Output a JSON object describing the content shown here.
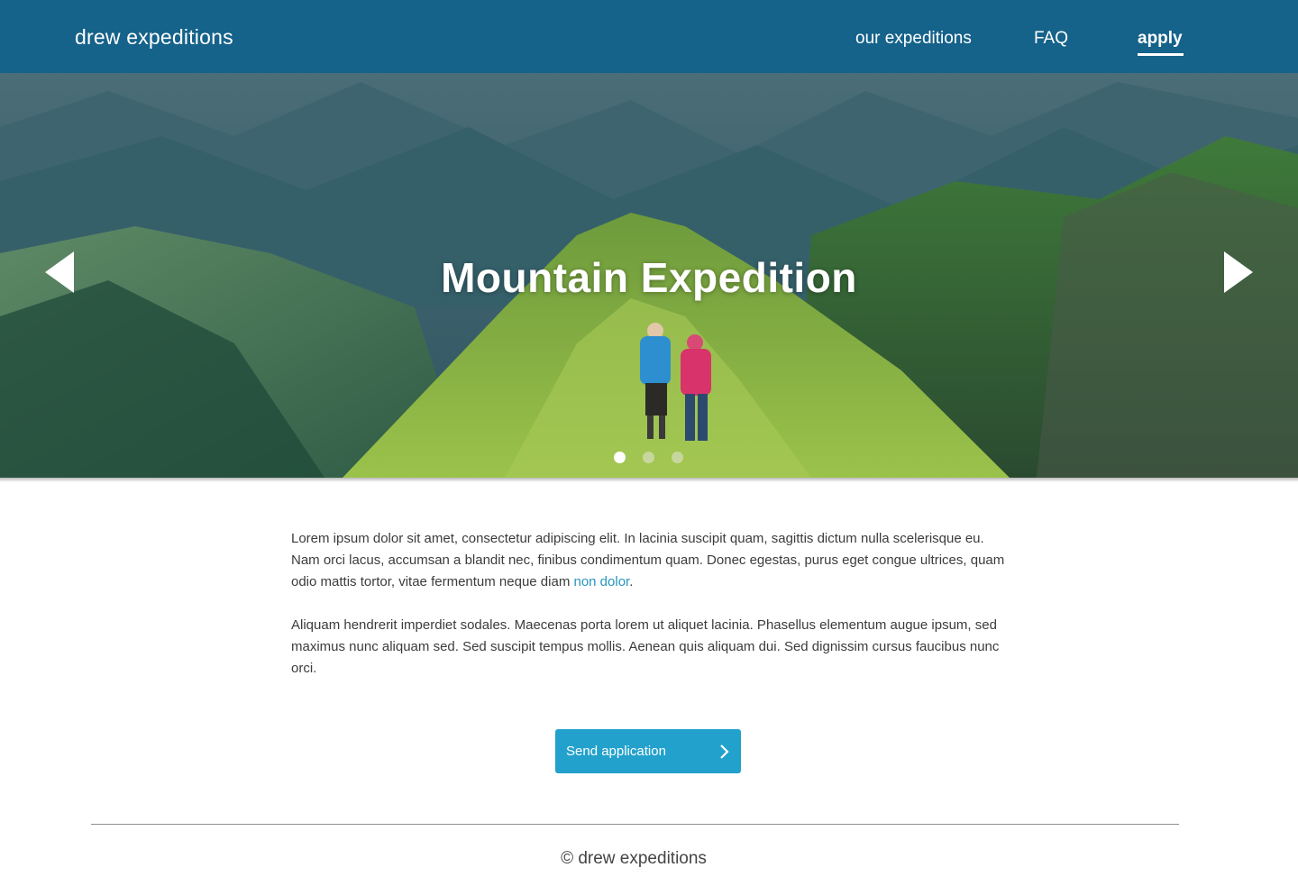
{
  "header": {
    "brand": "drew expeditions",
    "nav": [
      {
        "label": "our expeditions",
        "active": false
      },
      {
        "label": "FAQ",
        "active": false
      },
      {
        "label": "apply",
        "active": true
      }
    ]
  },
  "hero": {
    "title": "Mountain Expedition",
    "slides_total": 3,
    "active_slide": 1
  },
  "content": {
    "p1_text": "Lorem ipsum dolor sit amet, consectetur adipiscing elit. In lacinia suscipit quam, sagittis dictum nulla scelerisque eu. Nam orci lacus, accumsan a blandit nec, finibus condimentum quam. Donec egestas, purus eget congue ultrices, quam odio mattis tortor, vitae fermentum neque diam ",
    "p1_link": "non dolor",
    "p1_end": ".",
    "p2_text": "Aliquam hendrerit imperdiet sodales. Maecenas porta lorem ut aliquet lacinia. Phasellus elementum augue ipsum, sed maximus nunc aliquam sed. Sed suscipit tempus mollis. Aenean quis aliquam dui. Sed dignissim cursus faucibus nunc orci."
  },
  "cta": {
    "label": "Send application"
  },
  "footer": {
    "copyright": "© drew expeditions"
  },
  "colors": {
    "header_bg": "#15628a",
    "button_bg": "#22a1cd",
    "link": "#2596be",
    "body_text": "#3c3c3c"
  },
  "icons": {
    "prev": "triangle-left-icon",
    "next": "triangle-right-icon",
    "button": "chevron-right-icon"
  }
}
